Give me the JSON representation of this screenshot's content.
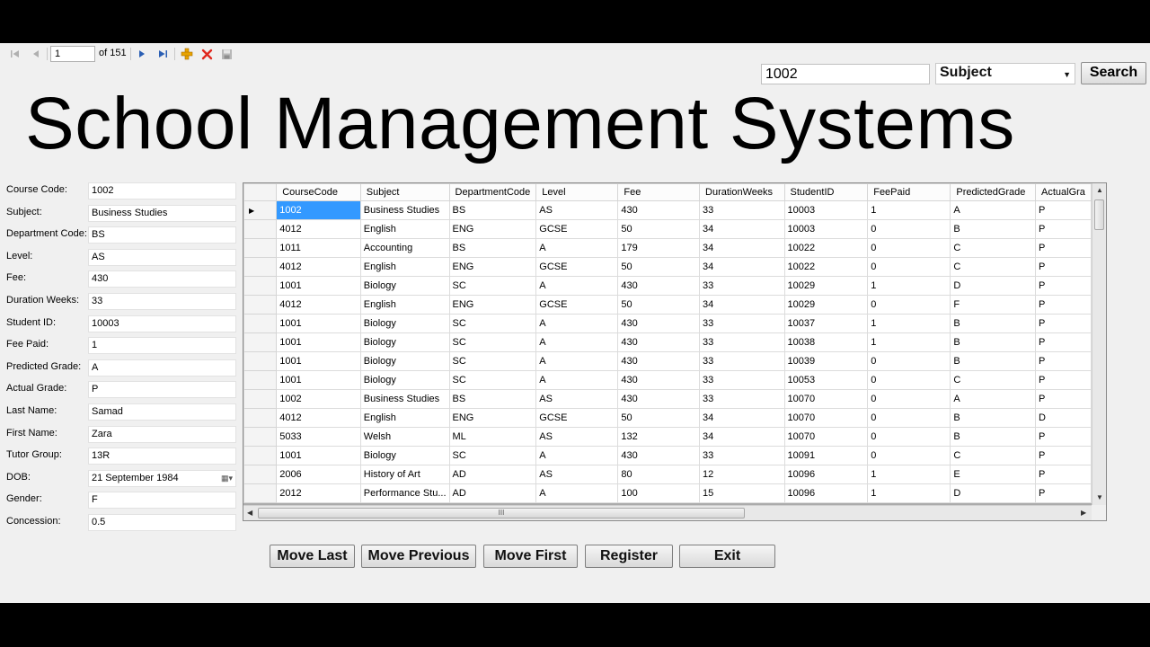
{
  "navigator": {
    "position": "1",
    "count": "of 151"
  },
  "search": {
    "value": "1002",
    "field": "Subject",
    "button": "Search"
  },
  "title": "School Management Systems",
  "fields": [
    {
      "label": "Course Code:",
      "value": "1002"
    },
    {
      "label": "Subject:",
      "value": "Business Studies"
    },
    {
      "label": "Department Code:",
      "value": "BS"
    },
    {
      "label": "Level:",
      "value": "AS"
    },
    {
      "label": "Fee:",
      "value": "430"
    },
    {
      "label": "Duration Weeks:",
      "value": "33"
    },
    {
      "label": "Student ID:",
      "value": "10003"
    },
    {
      "label": "Fee Paid:",
      "value": "1"
    },
    {
      "label": "Predicted Grade:",
      "value": "A"
    },
    {
      "label": "Actual Grade:",
      "value": "P"
    },
    {
      "label": "Last Name:",
      "value": "Samad"
    },
    {
      "label": "First Name:",
      "value": "Zara"
    },
    {
      "label": "Tutor Group:",
      "value": "13R"
    },
    {
      "label": "DOB:",
      "value": "21 September 1984"
    },
    {
      "label": "Gender:",
      "value": "F"
    },
    {
      "label": "Concession:",
      "value": "0.5"
    }
  ],
  "grid": {
    "columns": [
      "CourseCode",
      "Subject",
      "DepartmentCode",
      "Level",
      "Fee",
      "DurationWeeks",
      "StudentID",
      "FeePaid",
      "PredictedGrade",
      "ActualGra"
    ],
    "rows": [
      [
        "1002",
        "Business Studies",
        "BS",
        "AS",
        "430",
        "33",
        "10003",
        "1",
        "A",
        "P"
      ],
      [
        "4012",
        "English",
        "ENG",
        "GCSE",
        "50",
        "34",
        "10003",
        "0",
        "B",
        "P"
      ],
      [
        "1011",
        "Accounting",
        "BS",
        "A",
        "179",
        "34",
        "10022",
        "0",
        "C",
        "P"
      ],
      [
        "4012",
        "English",
        "ENG",
        "GCSE",
        "50",
        "34",
        "10022",
        "0",
        "C",
        "P"
      ],
      [
        "1001",
        "Biology",
        "SC",
        "A",
        "430",
        "33",
        "10029",
        "1",
        "D",
        "P"
      ],
      [
        "4012",
        "English",
        "ENG",
        "GCSE",
        "50",
        "34",
        "10029",
        "0",
        "F",
        "P"
      ],
      [
        "1001",
        "Biology",
        "SC",
        "A",
        "430",
        "33",
        "10037",
        "1",
        "B",
        "P"
      ],
      [
        "1001",
        "Biology",
        "SC",
        "A",
        "430",
        "33",
        "10038",
        "1",
        "B",
        "P"
      ],
      [
        "1001",
        "Biology",
        "SC",
        "A",
        "430",
        "33",
        "10039",
        "0",
        "B",
        "P"
      ],
      [
        "1001",
        "Biology",
        "SC",
        "A",
        "430",
        "33",
        "10053",
        "0",
        "C",
        "P"
      ],
      [
        "1002",
        "Business Studies",
        "BS",
        "AS",
        "430",
        "33",
        "10070",
        "0",
        "A",
        "P"
      ],
      [
        "4012",
        "English",
        "ENG",
        "GCSE",
        "50",
        "34",
        "10070",
        "0",
        "B",
        "D"
      ],
      [
        "5033",
        "Welsh",
        "ML",
        "AS",
        "132",
        "34",
        "10070",
        "0",
        "B",
        "P"
      ],
      [
        "1001",
        "Biology",
        "SC",
        "A",
        "430",
        "33",
        "10091",
        "0",
        "C",
        "P"
      ],
      [
        "2006",
        "History of Art",
        "AD",
        "AS",
        "80",
        "12",
        "10096",
        "1",
        "E",
        "P"
      ],
      [
        "2012",
        "Performance Stu...",
        "AD",
        "A",
        "100",
        "15",
        "10096",
        "1",
        "D",
        "P"
      ]
    ],
    "scroll_grip": "III"
  },
  "buttons": {
    "move_last": "Move Last",
    "move_previous": "Move Previous",
    "move_first": "Move First",
    "register": "Register",
    "exit": "Exit"
  },
  "colors": {
    "selection": "#3399ff",
    "add_icon": "#e8a300",
    "delete_icon": "#e0281e"
  }
}
